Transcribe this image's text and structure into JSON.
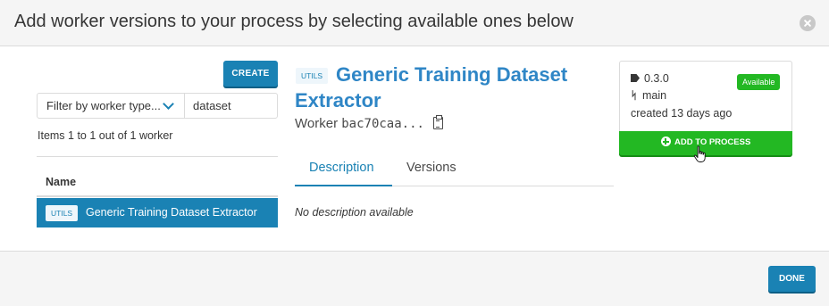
{
  "modal": {
    "title": "Add worker versions to your process by selecting available ones below"
  },
  "sidebar": {
    "create_label": "CREATE",
    "filter": {
      "selected": "Filter by worker type...",
      "search_value": "dataset"
    },
    "items_count": "Items 1 to 1 out of 1 worker",
    "table": {
      "columns": [
        "Name"
      ],
      "rows": [
        {
          "tag": "UTILS",
          "name": "Generic Training Dataset Extractor"
        }
      ]
    }
  },
  "worker": {
    "tag": "UTILS",
    "title": "Generic Training Dataset Extractor",
    "id_prefix": "Worker",
    "id_value": "bac70caa..."
  },
  "tabs": {
    "items": [
      {
        "label": "Description"
      },
      {
        "label": "Versions"
      }
    ],
    "active": "Description"
  },
  "description_text": "No description available",
  "version_card": {
    "version": "0.3.0",
    "branch": "main",
    "created": "created 13 days ago",
    "status": "Available",
    "add_label": "ADD TO PROCESS"
  },
  "footer": {
    "done_label": "DONE"
  },
  "colors": {
    "primary": "#1a82b4",
    "title_link": "#2f86c6",
    "success": "#23b823",
    "header_bg": "#f5f5f5",
    "border": "#dbdbdb"
  },
  "icons": [
    "close-icon",
    "chevron-down-icon",
    "clipboard-icon",
    "tag-icon",
    "branch-icon",
    "plus-circle-icon",
    "hand-cursor-icon"
  ]
}
